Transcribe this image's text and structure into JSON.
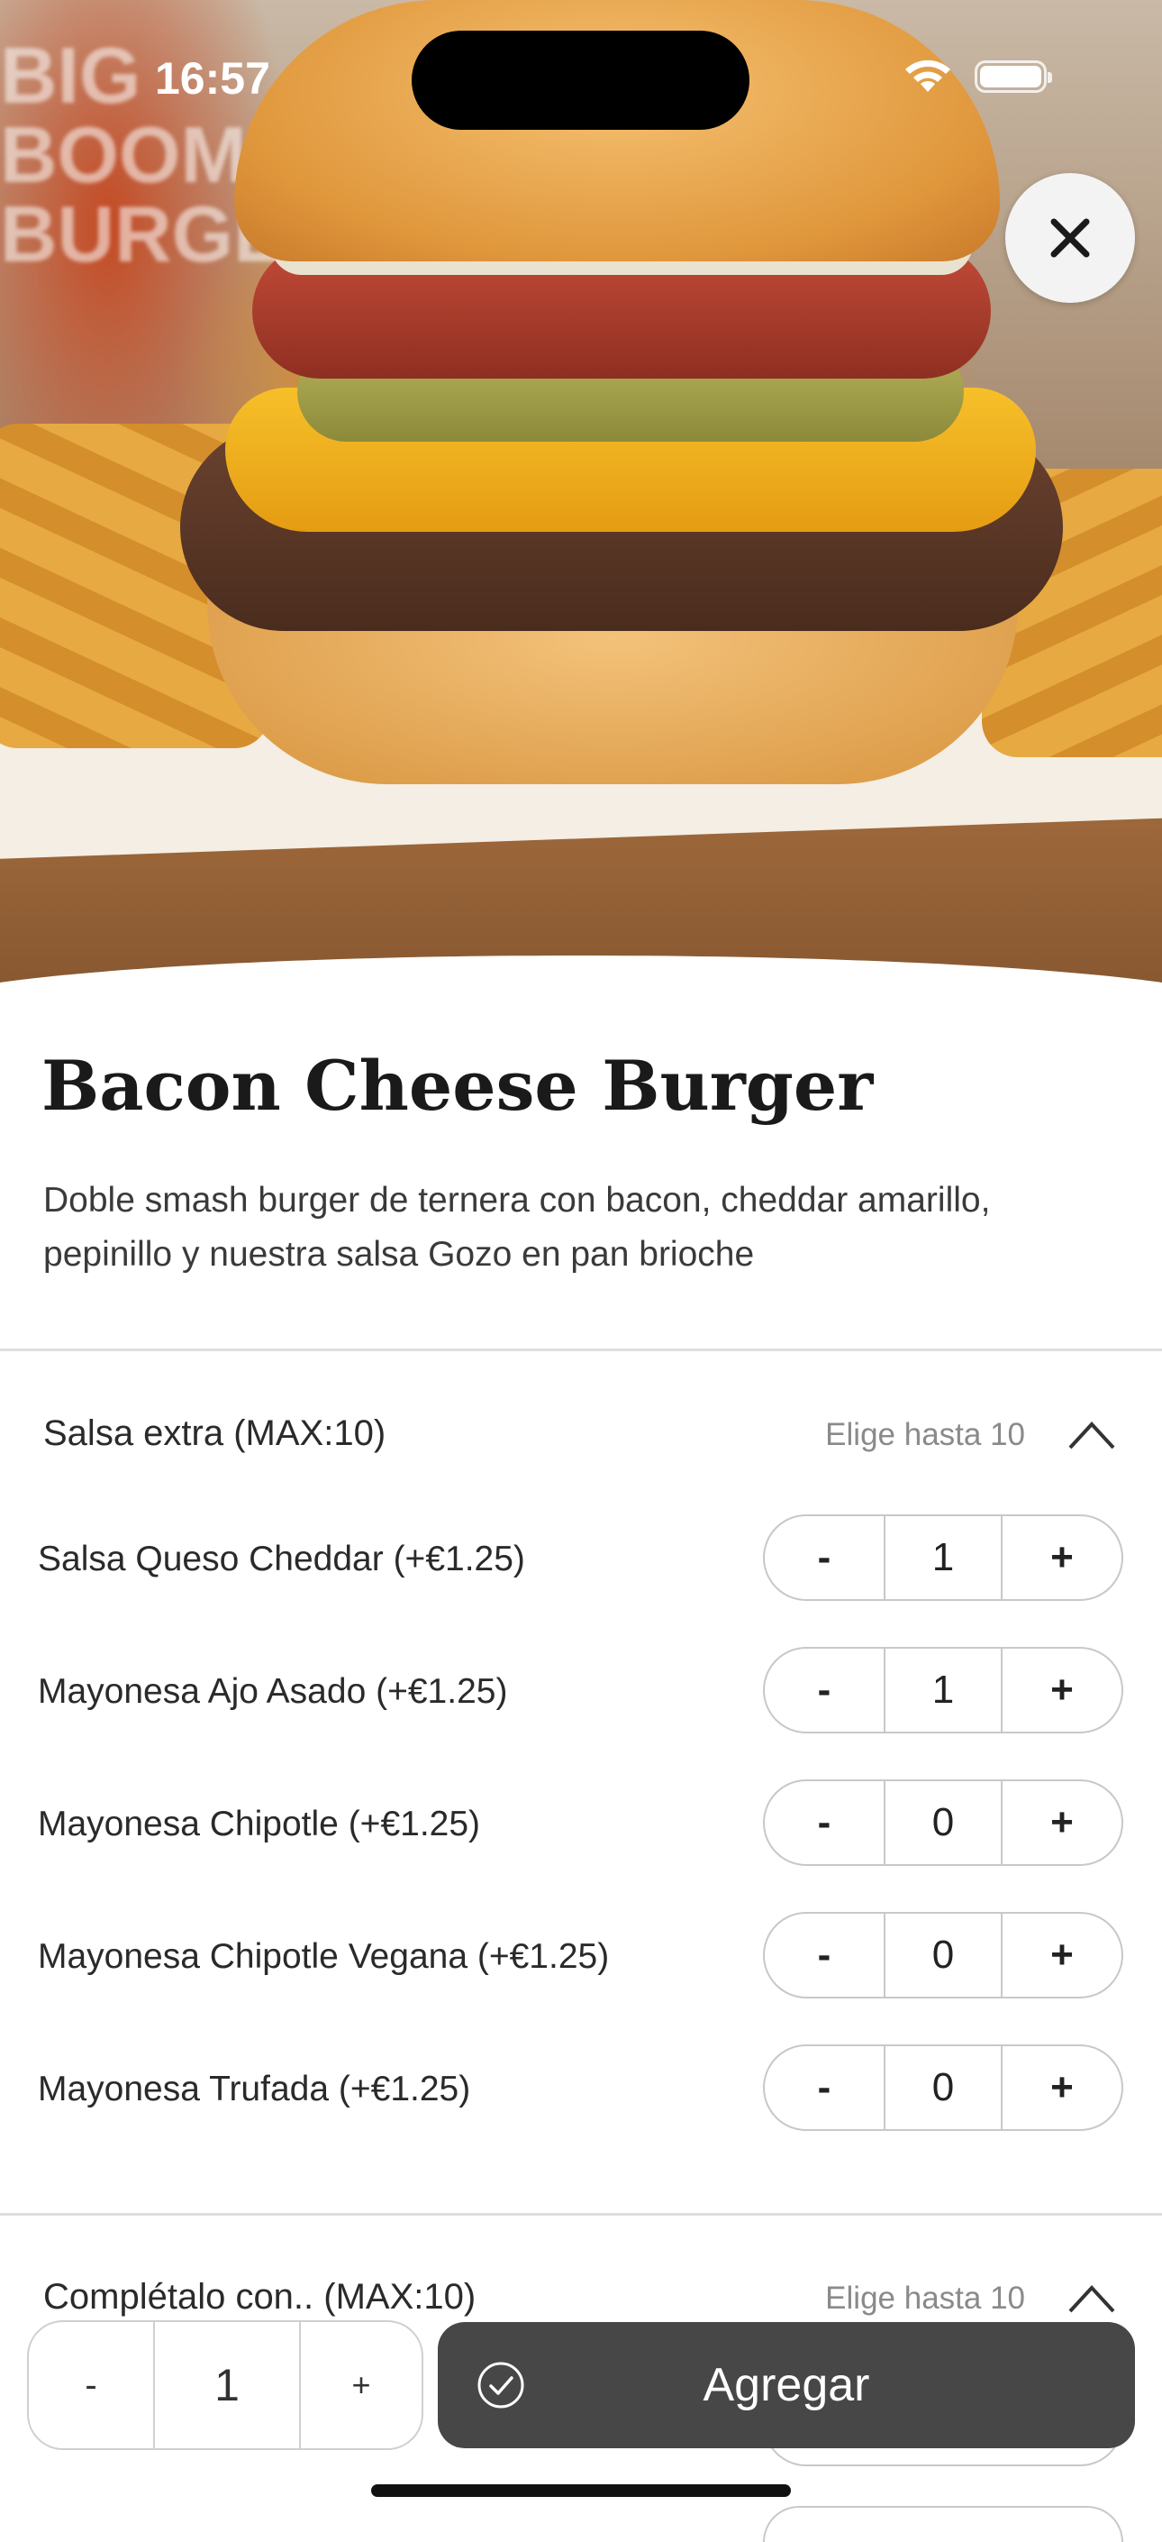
{
  "status_bar": {
    "time": "16:57"
  },
  "hero": {
    "sign_text": "BIG\nBOOM\nBURGE"
  },
  "product": {
    "title": "Bacon Cheese Burger",
    "description": "Doble smash burger de ternera con bacon, cheddar amarillo, pepinillo y nuestra salsa Gozo en pan brioche"
  },
  "sections": [
    {
      "label": "Salsa extra (MAX:10)",
      "hint": "Elige hasta 10",
      "options": [
        {
          "name": "Salsa Queso Cheddar (+€1.25)",
          "qty": "1"
        },
        {
          "name": "Mayonesa Ajo Asado (+€1.25)",
          "qty": "1"
        },
        {
          "name": "Mayonesa Chipotle (+€1.25)",
          "qty": "0"
        },
        {
          "name": "Mayonesa Chipotle Vegana (+€1.25)",
          "qty": "0"
        },
        {
          "name": "Mayonesa Trufada (+€1.25)",
          "qty": "0"
        }
      ]
    },
    {
      "label": "Complétalo con.. (MAX:10)",
      "hint": "Elige hasta 10"
    }
  ],
  "stepper_symbols": {
    "minus": "-",
    "plus": "+"
  },
  "bottom_bar": {
    "minus": "-",
    "quantity": "1",
    "plus": "+",
    "add_label": "Agregar"
  },
  "icons": {
    "close": "close-icon",
    "chevron": "chevron-up-icon",
    "check": "check-circle-icon"
  },
  "colors": {
    "add_button": "#474747",
    "divider": "#dedede"
  }
}
